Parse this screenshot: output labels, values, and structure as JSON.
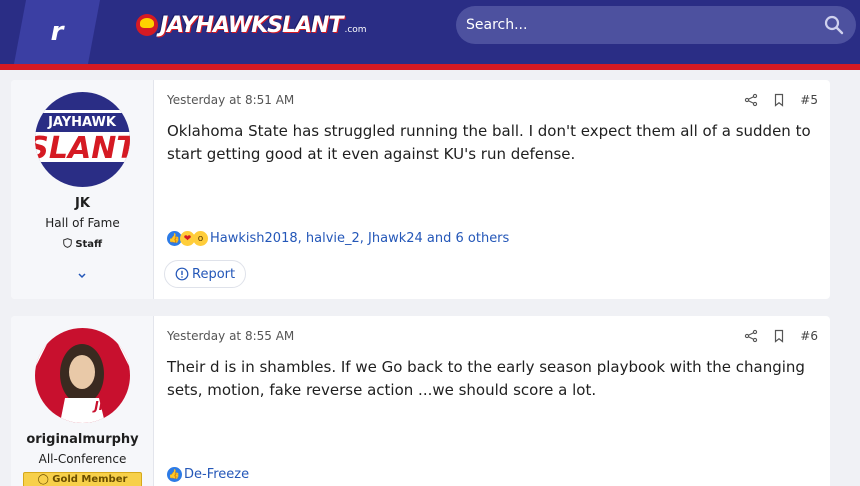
{
  "header": {
    "brand_letter": "r",
    "logo_text": "JAYHAWKSLANT",
    "logo_suffix": ".com",
    "search_placeholder": "Search..."
  },
  "posts": [
    {
      "username": "JK",
      "user_title": "Hall of Fame",
      "badge": "Staff",
      "avatar_text_top": "JAYHAWK",
      "avatar_text_bottom": "SLANT",
      "date": "Yesterday at 8:51 AM",
      "number": "#5",
      "content": "Oklahoma State has struggled running the ball. I don't expect them all of a sudden to start getting good at it even against KU's run defense.",
      "reactions_text": "Hawkish2018, halvie_2, Jhawk24 and 6 others",
      "report_label": "Report"
    },
    {
      "username": "originalmurphy",
      "user_title": "All-Conference",
      "badge": "Gold Member",
      "avatar_text": "JFC",
      "date": "Yesterday at 8:55 AM",
      "number": "#6",
      "content": "Their d is in shambles. If we Go back to the early season playbook with the changing sets, motion, fake reverse action ...we should score a lot.",
      "reactions_text": "De-Freeze"
    }
  ],
  "colors": {
    "header_bg": "#2a2d85",
    "header_accent": "#d51a23",
    "link": "#2457b8"
  }
}
